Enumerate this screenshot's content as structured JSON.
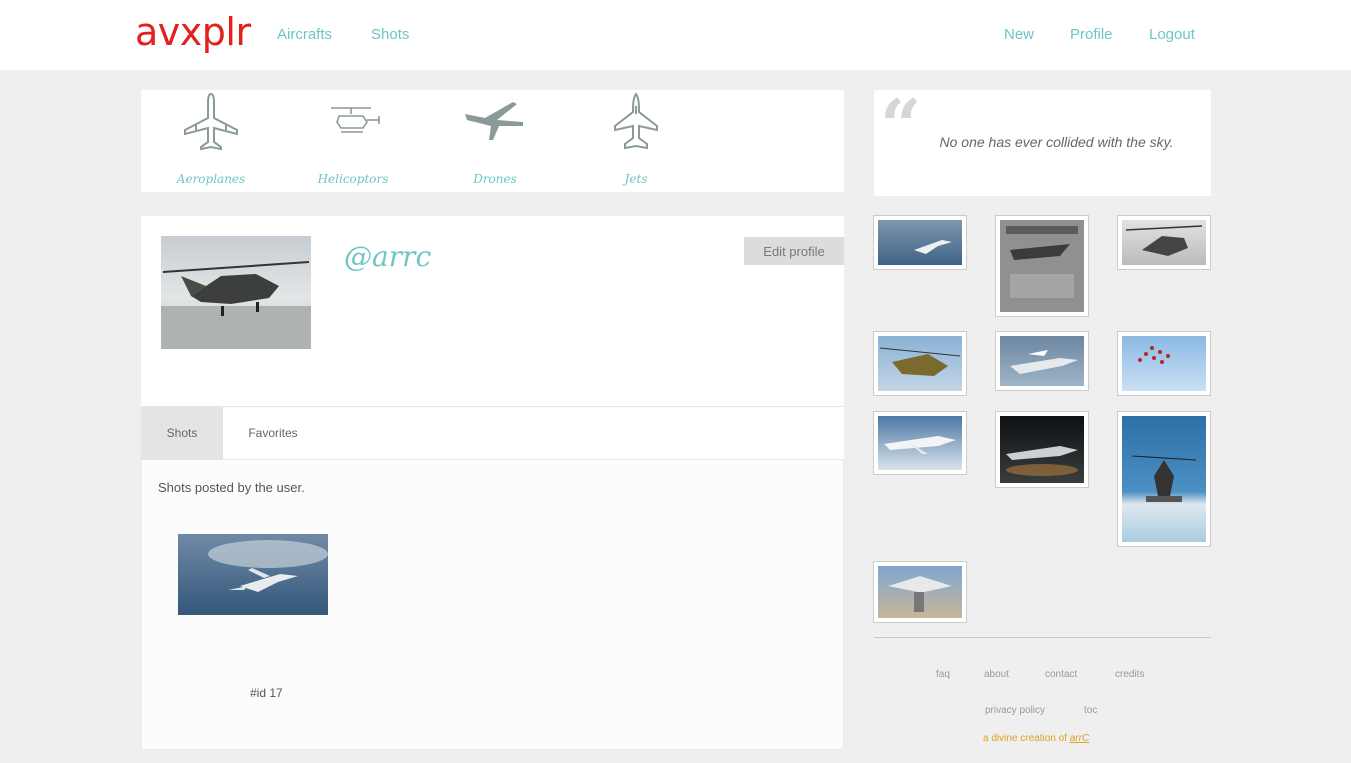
{
  "header": {
    "logo": "avxplr",
    "nav_left": [
      "Aircrafts",
      "Shots"
    ],
    "nav_right": [
      "New",
      "Profile",
      "Logout"
    ]
  },
  "categories": [
    "Aeroplanes",
    "Helicoptors",
    "Drones",
    "Jets"
  ],
  "quote": {
    "mark": "“",
    "text": "No one has ever collided with the sky."
  },
  "profile": {
    "username": "@arrc",
    "edit_label": "Edit profile"
  },
  "tabs": [
    "Shots",
    "Favorites"
  ],
  "shots_tab": {
    "description": "Shots posted by the user.",
    "shot_id": "#id 17"
  },
  "footer": {
    "links_row1": [
      "faq",
      "about",
      "contact",
      "credits"
    ],
    "links_row2": [
      "privacy policy",
      "toc"
    ],
    "credit_prefix": "a divine creation of ",
    "credit_author": "arrC"
  },
  "colors": {
    "brand": "#e0211d",
    "accent": "#6ec6c4",
    "credit": "#e0a020"
  }
}
